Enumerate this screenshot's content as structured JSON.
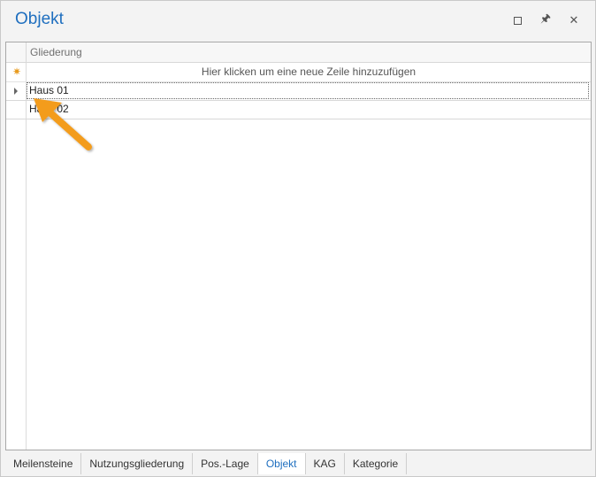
{
  "window": {
    "title": "Objekt",
    "controls": {
      "maximize_icon": "maximize-icon",
      "pin_glyph": "🖈",
      "close_glyph": "✕"
    }
  },
  "grid": {
    "columns": [
      {
        "header": "Gliederung"
      }
    ],
    "new_row_text": "Hier klicken um eine neue Zeile hinzuzufügen",
    "new_row_glyph": "✷",
    "rows": [
      {
        "value": "Haus 01",
        "focused": true
      },
      {
        "value": "Haus 02",
        "focused": false
      }
    ]
  },
  "tabs": [
    {
      "label": "Meilensteine",
      "active": false
    },
    {
      "label": "Nutzungsgliederung",
      "active": false
    },
    {
      "label": "Pos.-Lage",
      "active": false
    },
    {
      "label": "Objekt",
      "active": true
    },
    {
      "label": "KAG",
      "active": false
    },
    {
      "label": "Kategorie",
      "active": false
    }
  ],
  "colors": {
    "accent": "#1f6fbf",
    "annotation_arrow": "#f39c1e"
  }
}
